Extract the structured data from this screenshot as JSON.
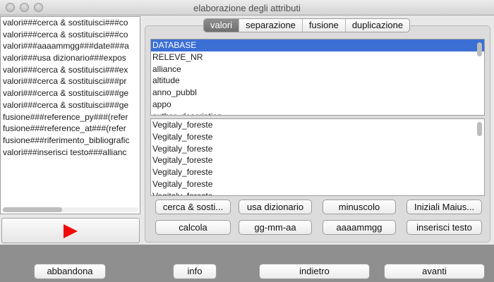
{
  "window": {
    "title": "elaborazione degli attributi",
    "controls": [
      "close",
      "minimize",
      "zoom"
    ]
  },
  "left_list": {
    "items": [
      "valori###cerca & sostituisci###co",
      "valori###cerca & sostituisci###co",
      "valori###aaaammgg###date###a",
      "valori###usa dizionario###expos",
      "valori###cerca & sostituisci###ex",
      "valori###cerca & sostituisci###pr",
      "valori###cerca & sostituisci###ge",
      "valori###cerca & sostituisci###ge",
      "fusione###reference_py###(refer",
      "fusione###reference_at###(refer",
      "fusione###riferimento_bibliografic",
      "valori###inserisci testo###allianc"
    ]
  },
  "play_button": {
    "icon": "play-icon",
    "color": "#f00a0a"
  },
  "tabs": [
    {
      "label": "valori",
      "active": true
    },
    {
      "label": "separazione",
      "active": false
    },
    {
      "label": "fusione",
      "active": false
    },
    {
      "label": "duplicazione",
      "active": false
    }
  ],
  "fields_list": {
    "items": [
      "DATABASE",
      "RELEVE_NR",
      "alliance",
      "altitude",
      "anno_pubbl",
      "appo",
      "author_description"
    ],
    "selected_index": 0
  },
  "values_list": {
    "items": [
      "Vegitaly_foreste",
      "Vegitaly_foreste",
      "Vegitaly_foreste",
      "Vegitaly_foreste",
      "Vegitaly_foreste",
      "Vegitaly_foreste",
      "Vegitaly_foreste"
    ]
  },
  "action_buttons": {
    "row1": [
      "cerca & sosti...",
      "usa dizionario",
      "minuscolo",
      "Iniziali Maius..."
    ],
    "row2": [
      "calcola",
      "gg-mm-aa",
      "aaaammgg",
      "inserisci testo"
    ]
  },
  "bottom_buttons": {
    "abandon": "abbandona",
    "info": "info",
    "back": "indietro",
    "next": "avanti"
  },
  "colors": {
    "selection": "#3b6fd4",
    "active_tab": "#7e7e7e",
    "bottom_bar": "#8f8f8f"
  }
}
